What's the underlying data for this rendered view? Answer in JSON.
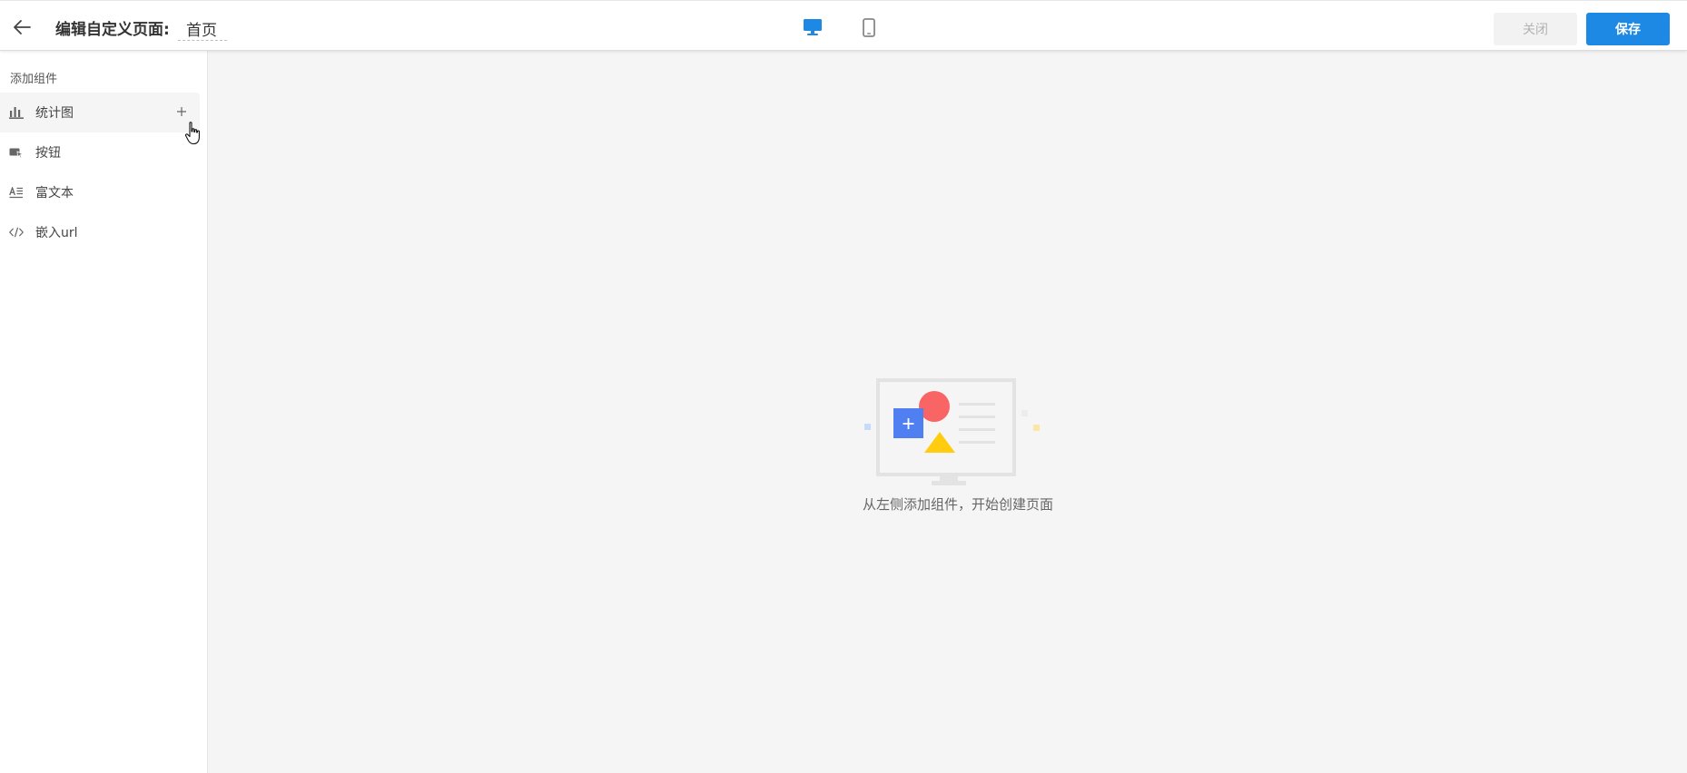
{
  "header": {
    "page_title_label": "编辑自定义页面:",
    "page_name": "首页",
    "close_label": "关闭",
    "save_label": "保存",
    "active_device": "desktop"
  },
  "colors": {
    "primary": "#1e88e5",
    "close_button_bg": "#f2f2f2",
    "close_button_text": "#b3b3b3",
    "canvas_bg": "#f5f5f5",
    "illustration_blue": "#4f7ff0",
    "illustration_red": "#f96464",
    "illustration_yellow": "#ffcc0f"
  },
  "sidebar": {
    "heading": "添加组件",
    "items": [
      {
        "label": "统计图",
        "icon": "bar-chart-icon",
        "hovered": true
      },
      {
        "label": "按钮",
        "icon": "button-cursor-icon",
        "hovered": false
      },
      {
        "label": "富文本",
        "icon": "rich-text-icon",
        "hovered": false
      },
      {
        "label": "嵌入url",
        "icon": "code-embed-icon",
        "hovered": false
      }
    ]
  },
  "canvas": {
    "empty_message": "从左侧添加组件，开始创建页面",
    "illustration_icon": "monitor-shapes-icon"
  }
}
